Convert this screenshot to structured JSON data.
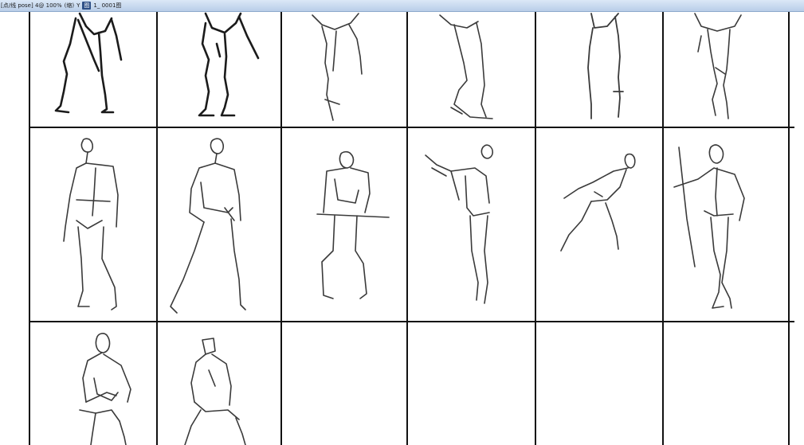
{
  "window": {
    "title_segments": [
      "[点/线 pose] 4@ 100%",
      "(缩)",
      "Y",
      "1_ 0001图"
    ],
    "tag_label": "图"
  },
  "sheet": {
    "rows": 3,
    "columns": 6,
    "cells": [
      {
        "row": 1,
        "col": 1,
        "content": "figure-sketch"
      },
      {
        "row": 1,
        "col": 2,
        "content": "figure-sketch"
      },
      {
        "row": 1,
        "col": 3,
        "content": "figure-sketch"
      },
      {
        "row": 1,
        "col": 4,
        "content": "figure-sketch"
      },
      {
        "row": 1,
        "col": 5,
        "content": "figure-sketch"
      },
      {
        "row": 1,
        "col": 6,
        "content": "figure-sketch"
      },
      {
        "row": 2,
        "col": 1,
        "content": "figure-sketch"
      },
      {
        "row": 2,
        "col": 2,
        "content": "figure-sketch"
      },
      {
        "row": 2,
        "col": 3,
        "content": "figure-sketch"
      },
      {
        "row": 2,
        "col": 4,
        "content": "figure-sketch"
      },
      {
        "row": 2,
        "col": 5,
        "content": "figure-sketch"
      },
      {
        "row": 2,
        "col": 6,
        "content": "figure-sketch"
      },
      {
        "row": 3,
        "col": 1,
        "content": "figure-sketch"
      },
      {
        "row": 3,
        "col": 2,
        "content": "figure-sketch"
      },
      {
        "row": 3,
        "col": 3,
        "content": "empty"
      },
      {
        "row": 3,
        "col": 4,
        "content": "empty"
      },
      {
        "row": 3,
        "col": 5,
        "content": "empty"
      },
      {
        "row": 3,
        "col": 6,
        "content": "empty"
      }
    ]
  },
  "colors": {
    "titlebar_top": "#dbe8f7",
    "titlebar_bottom": "#b9cde8",
    "grid_line": "#111111",
    "stroke": "#1b1b1b",
    "paper": "#ffffff"
  }
}
